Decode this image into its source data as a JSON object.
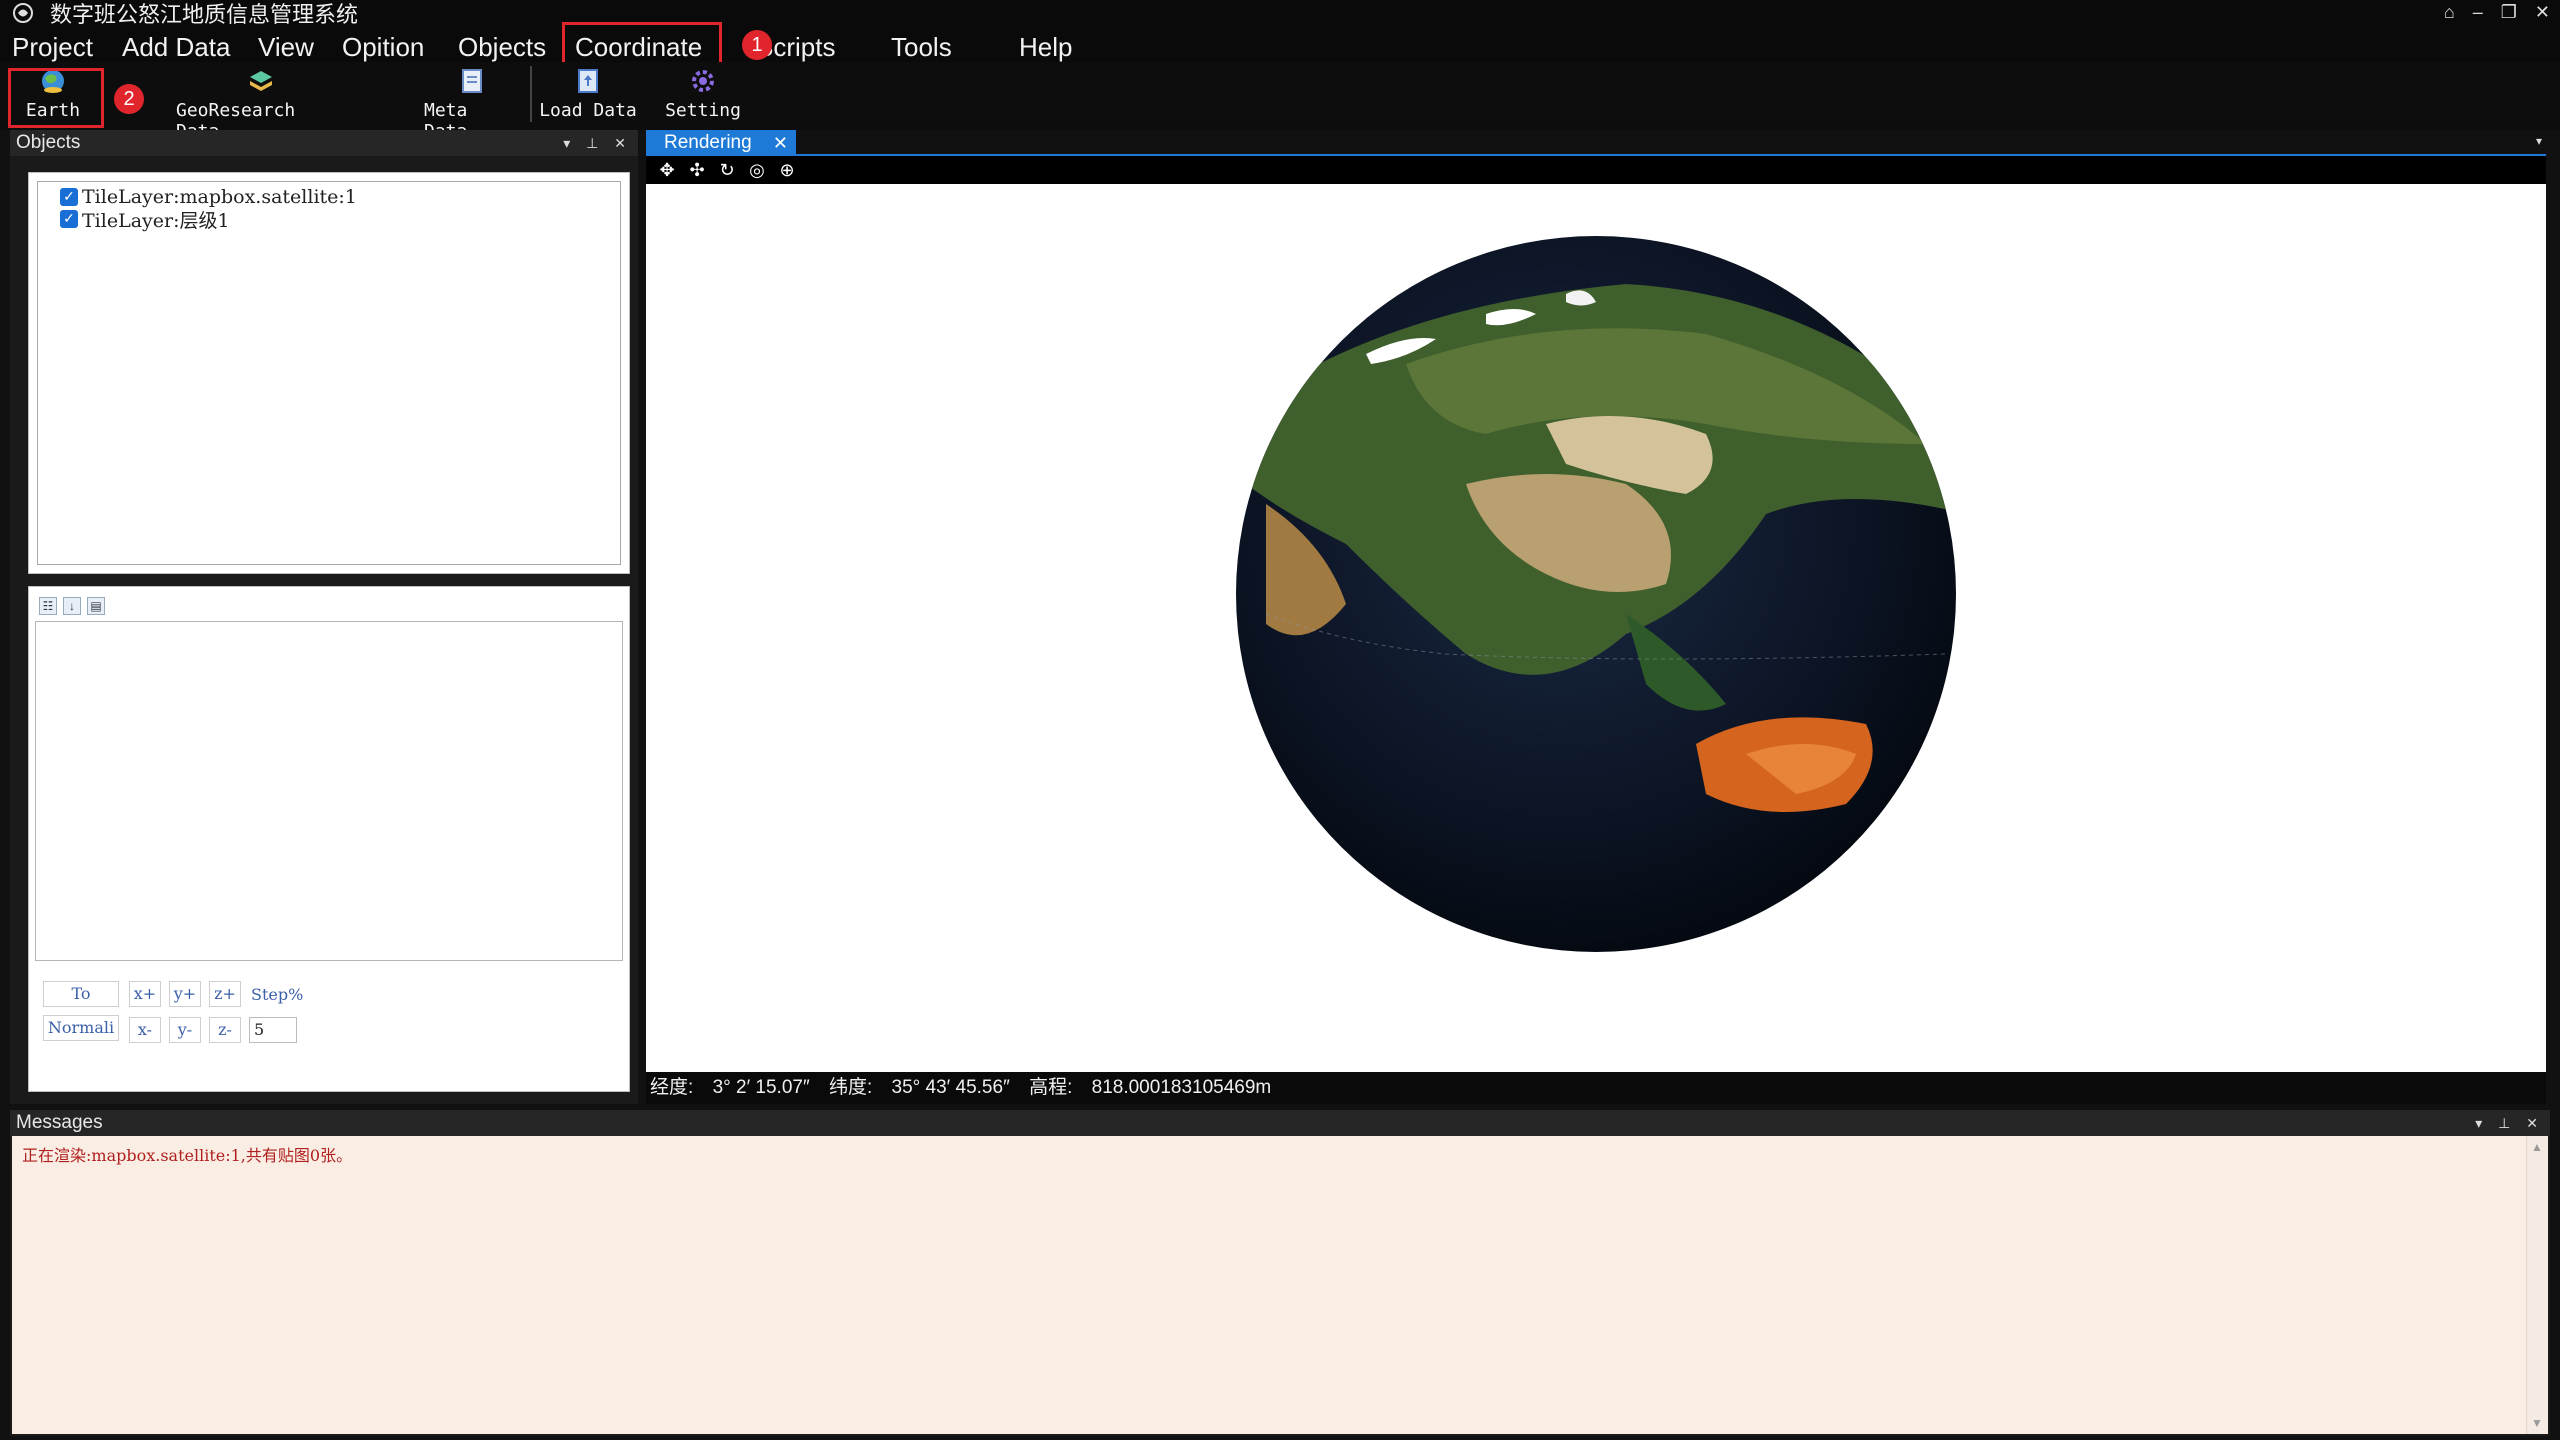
{
  "window": {
    "title": "数字班公怒江地质信息管理系统",
    "controls": [
      "⌂",
      "–",
      "❐",
      "✕"
    ]
  },
  "menu": {
    "items": [
      "Project",
      "Add Data",
      "View",
      "Opition",
      "Objects",
      "Coordinate",
      "Scripts",
      "Tools",
      "Help"
    ],
    "badge1": "1",
    "badge2": "2"
  },
  "toolbar": {
    "earth": "Earth",
    "georesearch": "GeoResearch Data",
    "metadata": "Meta Data",
    "loaddata": "Load Data",
    "setting": "Setting"
  },
  "objects_panel": {
    "title": "Objects",
    "layers": [
      "TileLayer:mapbox.satellite:1",
      "TileLayer:层级1"
    ],
    "buttons": {
      "to": "To",
      "normal": "Normali",
      "xplus": "x+",
      "yplus": "y+",
      "zplus": "z+",
      "xminus": "x-",
      "yminus": "y-",
      "zminus": "z-",
      "step": "Step%"
    },
    "step_value": "5"
  },
  "render": {
    "tab": "Rendering",
    "status": {
      "lon_label": "经度:",
      "lon_value": "3° 2′ 15.07″",
      "lat_label": "纬度:",
      "lat_value": "35° 43′ 45.56″",
      "alt_label": "高程:",
      "alt_value": "818.000183105469m"
    }
  },
  "messages": {
    "title": "Messages",
    "lines": [
      "正在渲染:mapbox.satellite:1,共有贴图0张。"
    ]
  },
  "colors": {
    "highlight_red": "#e0262c",
    "tab_blue": "#1e7ad6",
    "message_bg": "#faeee4",
    "message_text": "#b02020"
  }
}
